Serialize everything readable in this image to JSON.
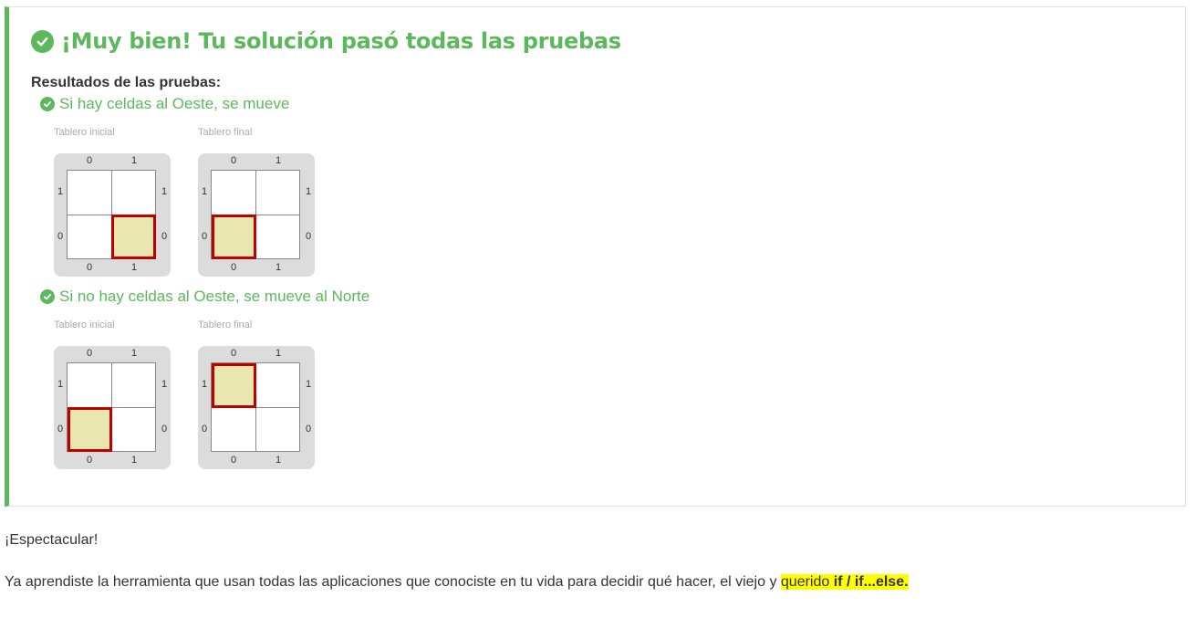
{
  "result": {
    "title": "¡Muy bien! Tu solución pasó todas las pruebas",
    "subtitle": "Resultados de las pruebas:",
    "tests": [
      {
        "name": "Si hay celdas al Oeste, se mueve",
        "initial_caption": "Tablero inicial",
        "final_caption": "Tablero final",
        "initial_head": {
          "col": 1,
          "row": 0
        },
        "final_head": {
          "col": 0,
          "row": 0
        }
      },
      {
        "name": "Si no hay celdas al Oeste, se mueve al Norte",
        "initial_caption": "Tablero inicial",
        "final_caption": "Tablero final",
        "initial_head": {
          "col": 0,
          "row": 0
        },
        "final_head": {
          "col": 0,
          "row": 1
        }
      }
    ],
    "board_labels": {
      "cols": [
        "0",
        "1"
      ],
      "rows": [
        "1",
        "0"
      ]
    }
  },
  "text": {
    "spectacular": "¡Espectacular!",
    "paragraph_plain": "Ya aprendiste la herramienta que usan todas las aplicaciones que conociste en tu vida para decidir qué hacer, el viejo y ",
    "paragraph_highlight": "querido ",
    "paragraph_code": "if / if...else."
  },
  "colors": {
    "success": "#5cb85c",
    "head_border": "#c00000",
    "head_fill": "#e9e6b0",
    "highlight": "#ffff00"
  },
  "icons": {
    "success_icon": "check-circle-icon"
  }
}
